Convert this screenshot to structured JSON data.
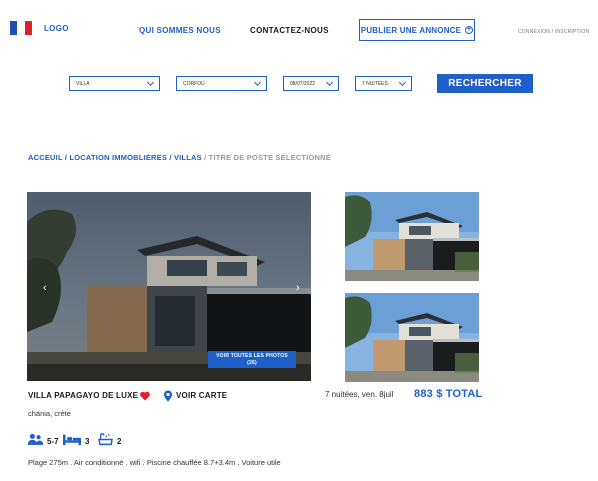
{
  "header": {
    "logo": "LOGO",
    "nav": {
      "who": "QUI SOMMES NOUS",
      "contact": "CONTACTEZ-NOUS"
    },
    "publish_label": "PUBLIER UNE ANNONCE",
    "auth": "CONNEXION / INSCRIPTION"
  },
  "search": {
    "type": "VILLA",
    "place": "CORFOU",
    "date": "08/07/2022",
    "nights": "7 NUITÉES",
    "button": "RECHERCHER"
  },
  "breadcrumb": {
    "items": [
      "ACCEUIL",
      "LOCATION IMMOBLIÈRES",
      "VILLAS"
    ],
    "separator": " / ",
    "current": "TITRE DE POSTE SÉLECTIONNÉ"
  },
  "gallery": {
    "all_photos_label": "VOIR TOUTES LES PHOTOS",
    "all_photos_count": "(26)"
  },
  "listing": {
    "title": "VILLA PAPAGAYO DE LUXE",
    "map_link": "VOIR CARTE",
    "nights_info": "7 nuitées, ven. 8juil",
    "total": "883 $ TOTAL",
    "location": "chania, crète",
    "features": {
      "guests": "5-7",
      "beds": "3",
      "baths": "2"
    },
    "amenities": "Plage 275m . Air conditionné . wifi . Piscine chauffée 8.7+3.4m . Voiture utile"
  },
  "colors": {
    "accent": "#1f5fc9",
    "heart": "#e0202e",
    "flag_blue": "#1f4fb5",
    "flag_red": "#e0202e"
  }
}
